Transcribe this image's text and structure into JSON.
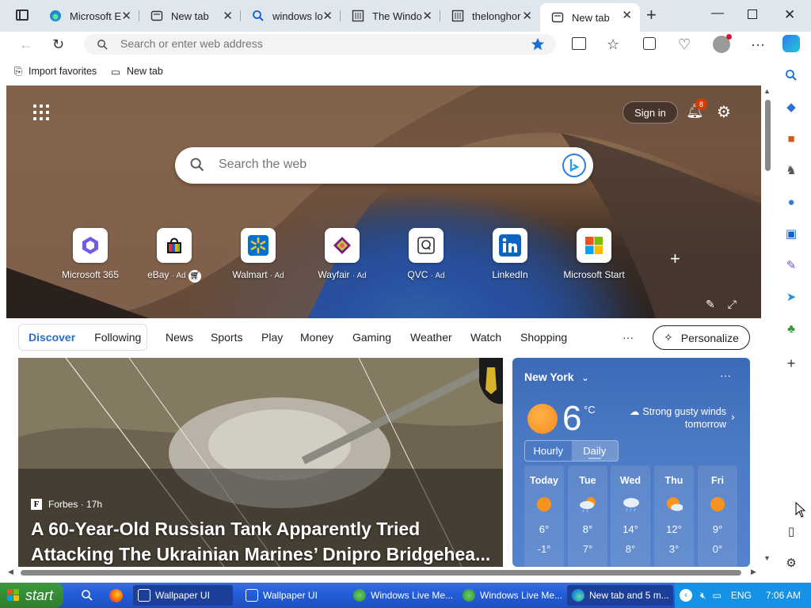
{
  "tabs": [
    {
      "title": "Microsoft E",
      "icon": "edge-icon"
    },
    {
      "title": "New tab",
      "icon": "newtab-icon"
    },
    {
      "title": "windows lo",
      "icon": "search-icon"
    },
    {
      "title": "The Windo",
      "icon": "site-icon"
    },
    {
      "title": "thelonghor",
      "icon": "site-icon"
    },
    {
      "title": "New tab",
      "icon": "newtab-icon",
      "active": true
    }
  ],
  "address": {
    "placeholder": "Search or enter web address"
  },
  "favorites": [
    {
      "label": "Import favorites"
    },
    {
      "label": "New tab"
    }
  ],
  "ntp": {
    "signin": "Sign in",
    "notifications": "8",
    "search_placeholder": "Search the web",
    "quicklinks": [
      {
        "label": "Microsoft 365",
        "ad": ""
      },
      {
        "label": "eBay",
        "ad": "· Ad"
      },
      {
        "label": "Walmart",
        "ad": "· Ad"
      },
      {
        "label": "Wayfair",
        "ad": "· Ad"
      },
      {
        "label": "QVC",
        "ad": "· Ad"
      },
      {
        "label": "LinkedIn",
        "ad": ""
      },
      {
        "label": "Microsoft Start",
        "ad": ""
      }
    ]
  },
  "feed": {
    "discover": "Discover",
    "following": "Following",
    "nav": [
      "News",
      "Sports",
      "Play",
      "Money",
      "Gaming",
      "Weather",
      "Watch",
      "Shopping"
    ],
    "more": "···",
    "personalize": "Personalize"
  },
  "article": {
    "source": "Forbes",
    "age": "17h",
    "source_logo": "F",
    "headline": "A 60-Year-Old Russian Tank Apparently Tried Attacking The Ukrainian Marines’ Dnipro Bridgehea..."
  },
  "weather": {
    "city": "New York",
    "temp": "6",
    "unit": "°C",
    "desc": "Strong gusty winds tomorrow",
    "hourly": "Hourly",
    "daily": "Daily",
    "days": [
      {
        "name": "Today",
        "hi": "6°",
        "lo": "-1°",
        "icon": "sun-icon"
      },
      {
        "name": "Tue",
        "hi": "8°",
        "lo": "7°",
        "icon": "rain-sun-icon"
      },
      {
        "name": "Wed",
        "hi": "14°",
        "lo": "8°",
        "icon": "rain-icon"
      },
      {
        "name": "Thu",
        "hi": "12°",
        "lo": "3°",
        "icon": "partly-sunny-icon"
      },
      {
        "name": "Fri",
        "hi": "9°",
        "lo": "0°",
        "icon": "sun-icon"
      }
    ]
  },
  "taskbar": {
    "start": "start",
    "items": [
      {
        "label": "Wallpaper UI",
        "active": true
      },
      {
        "label": "Wallpaper UI"
      },
      {
        "label": "Windows Live Me..."
      },
      {
        "label": "Windows Live Me..."
      },
      {
        "label": "New tab and 5 m..."
      }
    ],
    "lang": "ENG",
    "time": "7:06 AM"
  }
}
